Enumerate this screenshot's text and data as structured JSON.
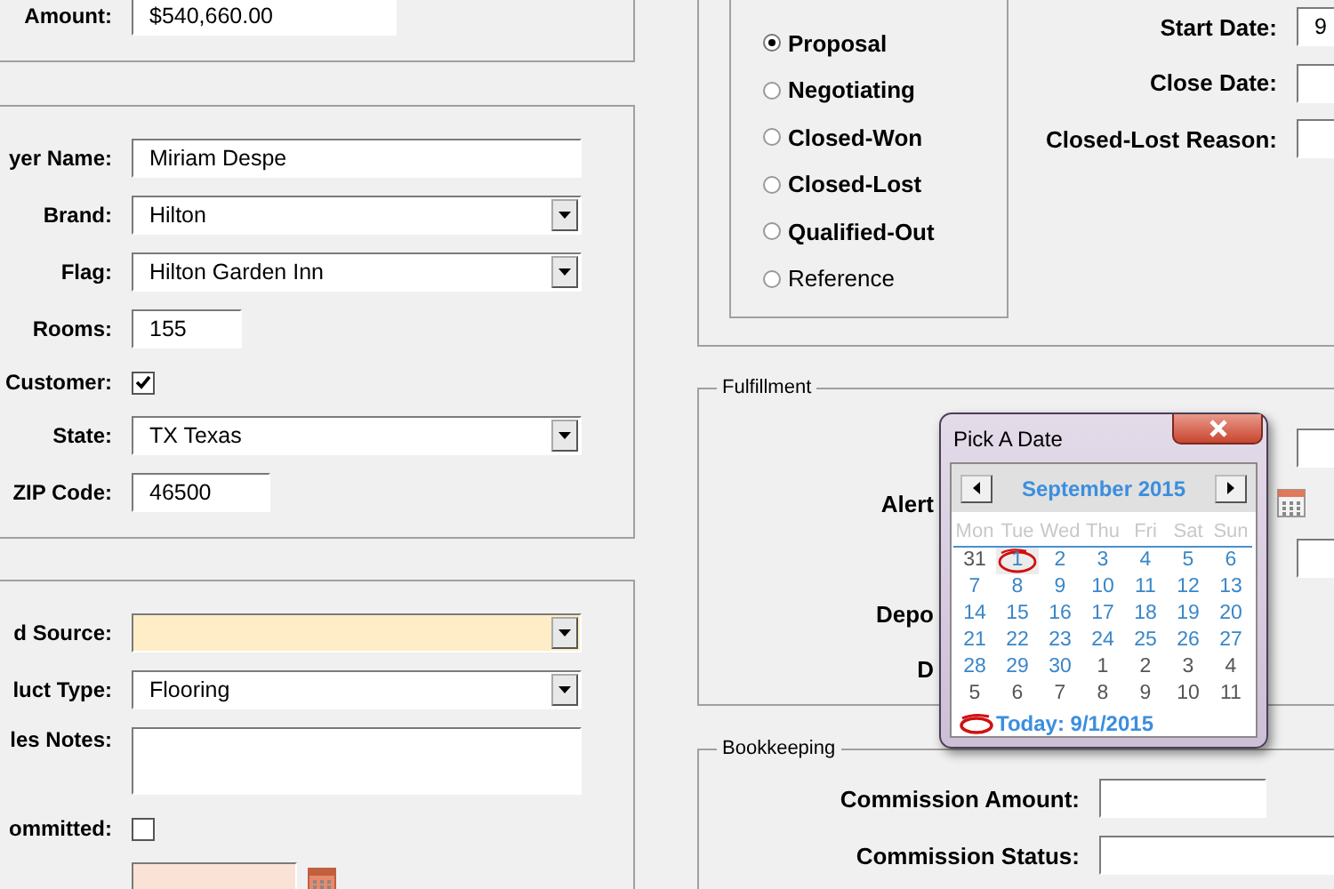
{
  "deal": {
    "rows": [
      {
        "kind": "text",
        "label": "Amount:",
        "value": "$540,660.00"
      }
    ]
  },
  "property": {
    "rows": [
      {
        "kind": "text",
        "label": "yer Name:",
        "value": "Miriam Despe"
      },
      {
        "kind": "dropdown",
        "label": "Brand:",
        "value": "Hilton"
      },
      {
        "kind": "dropdown",
        "label": "Flag:",
        "value": "Hilton Garden Inn"
      },
      {
        "kind": "text",
        "label": "Rooms:",
        "value": "155"
      },
      {
        "kind": "check",
        "label": "Customer:",
        "checked": true
      },
      {
        "kind": "dropdown",
        "label": "State:",
        "value": "TX Texas"
      },
      {
        "kind": "text",
        "label": "ZIP Code:",
        "value": "46500"
      }
    ]
  },
  "lead": {
    "rows": [
      {
        "kind": "dropdown",
        "label": "d Source:",
        "required": true
      },
      {
        "kind": "dropdown",
        "label": "luct Type:",
        "value": "Flooring",
        "required": false
      },
      {
        "kind": "textarea",
        "label": "les Notes:"
      },
      {
        "kind": "check",
        "label": "ommitted:",
        "checked": false
      },
      {
        "kind": "date"
      }
    ]
  },
  "status": {
    "options": [
      {
        "label": "Proposal",
        "selected": true,
        "bold": true
      },
      {
        "label": "Negotiating",
        "selected": false,
        "bold": true
      },
      {
        "label": "Closed-Won",
        "selected": false,
        "bold": true
      },
      {
        "label": "Closed-Lost",
        "selected": false,
        "bold": true
      },
      {
        "label": "Qualified-Out",
        "selected": false,
        "bold": true
      },
      {
        "label": "Reference",
        "selected": false,
        "bold": false
      }
    ],
    "fields": [
      {
        "label": "Start Date:",
        "value": "9"
      },
      {
        "label": "Close Date:"
      },
      {
        "label": "Closed-Lost Reason:"
      }
    ]
  },
  "fulfillment": {
    "legend": "Fulfillment",
    "rows": [
      {
        "kind": "field"
      },
      {
        "kind": "date",
        "label": "Alert"
      },
      {
        "kind": "field"
      },
      {
        "kind": "label",
        "label": "Depo"
      },
      {
        "kind": "label",
        "label": "D"
      }
    ]
  },
  "bookkeeping": {
    "legend": "Bookkeeping",
    "rows": [
      {
        "label": "Commission Amount:"
      },
      {
        "label": "Commission Status:"
      }
    ]
  },
  "date_picker": {
    "title": "Pick A Date",
    "month": "September 2015",
    "weekdays": [
      "Mon",
      "Tue",
      "Wed",
      "Thu",
      "Fri",
      "Sat",
      "Sun"
    ],
    "weeks": [
      [
        {
          "day": "31",
          "in_month": false,
          "selected": false
        },
        {
          "day": "1",
          "in_month": true,
          "selected": true
        },
        {
          "day": "2",
          "in_month": true,
          "selected": false
        },
        {
          "day": "3",
          "in_month": true,
          "selected": false
        },
        {
          "day": "4",
          "in_month": true,
          "selected": false
        },
        {
          "day": "5",
          "in_month": true,
          "selected": false
        },
        {
          "day": "6",
          "in_month": true,
          "selected": false
        }
      ],
      [
        {
          "day": "7",
          "in_month": true,
          "selected": false
        },
        {
          "day": "8",
          "in_month": true,
          "selected": false
        },
        {
          "day": "9",
          "in_month": true,
          "selected": false
        },
        {
          "day": "10",
          "in_month": true,
          "selected": false
        },
        {
          "day": "11",
          "in_month": true,
          "selected": false
        },
        {
          "day": "12",
          "in_month": true,
          "selected": false
        },
        {
          "day": "13",
          "in_month": true,
          "selected": false
        }
      ],
      [
        {
          "day": "14",
          "in_month": true,
          "selected": false
        },
        {
          "day": "15",
          "in_month": true,
          "selected": false
        },
        {
          "day": "16",
          "in_month": true,
          "selected": false
        },
        {
          "day": "17",
          "in_month": true,
          "selected": false
        },
        {
          "day": "18",
          "in_month": true,
          "selected": false
        },
        {
          "day": "19",
          "in_month": true,
          "selected": false
        },
        {
          "day": "20",
          "in_month": true,
          "selected": false
        }
      ],
      [
        {
          "day": "21",
          "in_month": true,
          "selected": false
        },
        {
          "day": "22",
          "in_month": true,
          "selected": false
        },
        {
          "day": "23",
          "in_month": true,
          "selected": false
        },
        {
          "day": "24",
          "in_month": true,
          "selected": false
        },
        {
          "day": "25",
          "in_month": true,
          "selected": false
        },
        {
          "day": "26",
          "in_month": true,
          "selected": false
        },
        {
          "day": "27",
          "in_month": true,
          "selected": false
        }
      ],
      [
        {
          "day": "28",
          "in_month": true,
          "selected": false
        },
        {
          "day": "29",
          "in_month": true,
          "selected": false
        },
        {
          "day": "30",
          "in_month": true,
          "selected": false
        },
        {
          "day": "1",
          "in_month": false,
          "selected": false
        },
        {
          "day": "2",
          "in_month": false,
          "selected": false
        },
        {
          "day": "3",
          "in_month": false,
          "selected": false
        },
        {
          "day": "4",
          "in_month": false,
          "selected": false
        }
      ],
      [
        {
          "day": "5",
          "in_month": false,
          "selected": false
        },
        {
          "day": "6",
          "in_month": false,
          "selected": false
        },
        {
          "day": "7",
          "in_month": false,
          "selected": false
        },
        {
          "day": "8",
          "in_month": false,
          "selected": false
        },
        {
          "day": "9",
          "in_month": false,
          "selected": false
        },
        {
          "day": "10",
          "in_month": false,
          "selected": false
        },
        {
          "day": "11",
          "in_month": false,
          "selected": false
        }
      ]
    ],
    "today": "Today: 9/1/2015"
  }
}
